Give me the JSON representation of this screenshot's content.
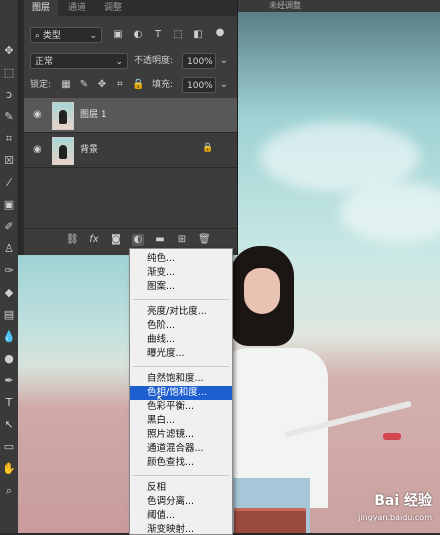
{
  "panel": {
    "tabs": [
      "图层",
      "通道",
      "调整"
    ],
    "filter_kind": "类型",
    "blend_mode": "正常",
    "opacity_label": "不透明度:",
    "opacity_value": "100%",
    "lock_label": "锁定:",
    "fill_label": "填充:",
    "fill_value": "100%",
    "layers": [
      {
        "name": "图层 1",
        "selected": true
      },
      {
        "name": "背景",
        "selected": false
      }
    ]
  },
  "top_strip_text": "未经调整",
  "menu": {
    "group1": [
      "纯色...",
      "渐变...",
      "图案..."
    ],
    "group2": [
      "亮度/对比度...",
      "色阶...",
      "曲线...",
      "曝光度..."
    ],
    "group3": [
      "自然饱和度...",
      "色相/饱和度...",
      "色彩平衡...",
      "黑白...",
      "照片滤镜...",
      "通道混合器...",
      "颜色查找..."
    ],
    "group4": [
      "反相",
      "色调分离...",
      "阈值...",
      "渐变映射..."
    ],
    "highlighted": "色相/饱和度..."
  },
  "watermark": {
    "brand": "Bai 经验",
    "url": "jingyan.baidu.com"
  },
  "colors": {
    "highlight": "#1d5fd0",
    "panel_bg": "#3c3c3c"
  }
}
